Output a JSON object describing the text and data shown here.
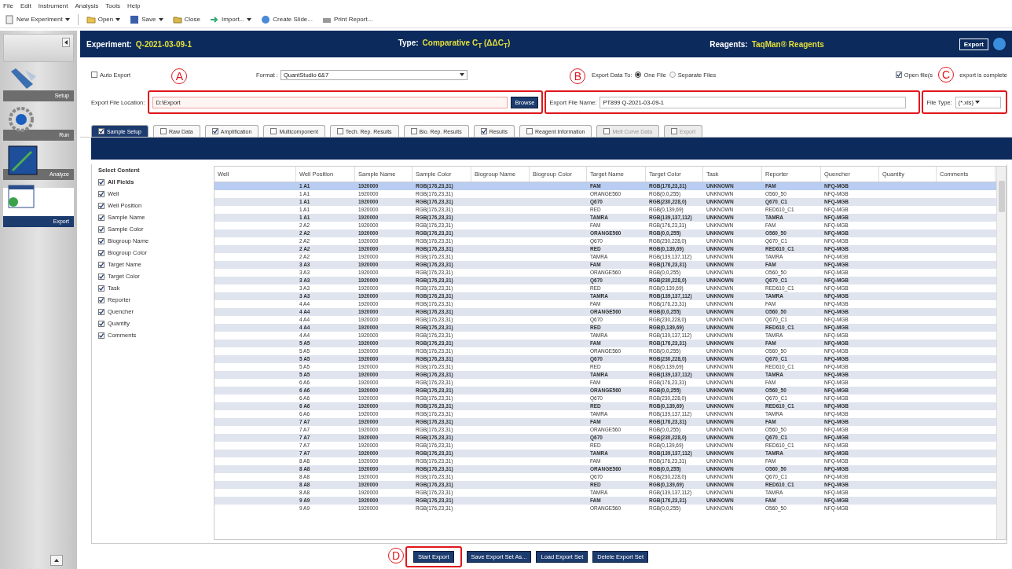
{
  "menu": [
    "File",
    "Edit",
    "Instrument",
    "Analysis",
    "Tools",
    "Help"
  ],
  "toolbar": [
    {
      "label": "New Experiment",
      "kind": "new",
      "dropdown": true
    },
    {
      "label": "Open",
      "kind": "open",
      "dropdown": true
    },
    {
      "label": "Save",
      "kind": "save",
      "dropdown": true
    },
    {
      "label": "Close",
      "kind": "close",
      "dropdown": false
    },
    {
      "label": "Import...",
      "kind": "import",
      "dropdown": true
    },
    {
      "label": "Create Slide...",
      "kind": "slide",
      "dropdown": false
    },
    {
      "label": "Print Report...",
      "kind": "print",
      "dropdown": false
    }
  ],
  "sidebar": {
    "items": [
      {
        "label": "Setup",
        "kind": "setup",
        "selected": false
      },
      {
        "label": "Run",
        "kind": "run",
        "selected": false
      },
      {
        "label": "Analyze",
        "kind": "analyze",
        "selected": false
      },
      {
        "label": "Export",
        "kind": "export",
        "selected": true
      }
    ]
  },
  "header": {
    "experiment_label": "Experiment:",
    "experiment": "Q-2021-03-09-1",
    "type_label": "Type:",
    "type": "Comparative C$_{T}$ (ΔΔC$_{T}$)",
    "reagents_label": "Reagents:",
    "reagents": "TaqMan® Reagents",
    "export_button": "Export"
  },
  "options": {
    "auto_export": {
      "label": "Auto Export",
      "checked": false
    },
    "format": {
      "label": "Format :",
      "value": "QuantStudio 6&7"
    },
    "export_data_to": {
      "label": "Export Data To:",
      "options": [
        {
          "label": "One File",
          "selected": true
        },
        {
          "label": "Separate Files",
          "selected": false
        }
      ]
    },
    "open_files": {
      "label_start": "Open file(s",
      "label_end": "export is complete",
      "checked": true
    },
    "location": {
      "label": "Export File Location:",
      "value": "D:\\Export",
      "button": "Browse",
      "annotation": "A"
    },
    "file_name": {
      "label": "Export File Name:",
      "value": "PT899 Q-2021-03-09-1",
      "annotation": "B"
    },
    "file_type": {
      "label": "File Type:",
      "value": "(*.xls)",
      "annotation": "C"
    }
  },
  "tabs": [
    {
      "label": "Sample Setup",
      "checked": true,
      "selected": true,
      "disabled": false
    },
    {
      "label": "Raw Data",
      "checked": false,
      "selected": false,
      "disabled": false
    },
    {
      "label": "Amplification",
      "checked": true,
      "selected": false,
      "disabled": false
    },
    {
      "label": "Multicomponent",
      "checked": false,
      "selected": false,
      "disabled": false
    },
    {
      "label": "Tech. Rep. Results",
      "checked": false,
      "selected": false,
      "disabled": false
    },
    {
      "label": "Bio. Rep. Results",
      "checked": false,
      "selected": false,
      "disabled": false
    },
    {
      "label": "Results",
      "checked": true,
      "selected": false,
      "disabled": false
    },
    {
      "label": "Reagent Information",
      "checked": false,
      "selected": false,
      "disabled": false
    },
    {
      "label": "Melt Curve Data",
      "checked": false,
      "selected": false,
      "disabled": true
    },
    {
      "label": "Export",
      "checked": false,
      "selected": false,
      "disabled": true
    }
  ],
  "content": {
    "title": "Select Content",
    "fields": [
      {
        "label": "All Fields",
        "kind": "all",
        "checked": true
      },
      {
        "label": "Well",
        "kind": "field",
        "checked": true
      },
      {
        "label": "Well Position",
        "kind": "field",
        "checked": true
      },
      {
        "label": "Sample Name",
        "kind": "field",
        "checked": true
      },
      {
        "label": "Sample Color",
        "kind": "field",
        "checked": true
      },
      {
        "label": "Biogroup Name",
        "kind": "field",
        "checked": true
      },
      {
        "label": "Biogroup Color",
        "kind": "field",
        "checked": true
      },
      {
        "label": "Target Name",
        "kind": "field",
        "checked": true
      },
      {
        "label": "Target Color",
        "kind": "field",
        "checked": true
      },
      {
        "label": "Task",
        "kind": "field",
        "checked": true
      },
      {
        "label": "Reporter",
        "kind": "field",
        "checked": true
      },
      {
        "label": "Quencher",
        "kind": "field",
        "checked": true
      },
      {
        "label": "Quantity",
        "kind": "field",
        "checked": true
      },
      {
        "label": "Comments",
        "kind": "field",
        "checked": true
      }
    ]
  },
  "table": {
    "columns": [
      "Well",
      "Well Position",
      "Sample Name",
      "Sample Color",
      "Biogroup Name",
      "Biogroup Color",
      "Target Name",
      "Target Color",
      "Task",
      "Reporter",
      "Quencher",
      "Quantity",
      "Comments"
    ],
    "rows": [
      {
        "selected": true,
        "cells": [
          "",
          "1 A1",
          "1920000",
          "RGB(176,23,31)",
          "",
          "",
          "FAM",
          "RGB(176,23,31)",
          "UNKNOWN",
          "FAM",
          "NFQ-MGB",
          "",
          ""
        ]
      },
      {
        "selected": false,
        "cells": [
          "",
          "1 A1",
          "1920000",
          "RGB(176,23,31)",
          "",
          "",
          "ORANGE560",
          "RGB(0,0,255)",
          "UNKNOWN",
          "O560_50",
          "NFQ-MGB",
          "",
          ""
        ]
      },
      {
        "selected": false,
        "cells": [
          "",
          "1 A1",
          "1920000",
          "RGB(176,23,31)",
          "",
          "",
          "Q670",
          "RGB(230,228,0)",
          "UNKNOWN",
          "Q670_C1",
          "NFQ-MGB",
          "",
          ""
        ]
      },
      {
        "selected": false,
        "cells": [
          "",
          "1 A1",
          "1920000",
          "RGB(176,23,31)",
          "",
          "",
          "RED",
          "RGB(0,139,69)",
          "UNKNOWN",
          "RED610_C1",
          "NFQ-MGB",
          "",
          ""
        ]
      },
      {
        "selected": false,
        "cells": [
          "",
          "1 A1",
          "1920000",
          "RGB(176,23,31)",
          "",
          "",
          "TAMRA",
          "RGB(139,137,112)",
          "UNKNOWN",
          "TAMRA",
          "NFQ-MGB",
          "",
          ""
        ]
      },
      {
        "selected": false,
        "cells": [
          "",
          "2 A2",
          "1920000",
          "RGB(176,23,31)",
          "",
          "",
          "FAM",
          "RGB(176,23,31)",
          "UNKNOWN",
          "FAM",
          "NFQ-MGB",
          "",
          ""
        ]
      },
      {
        "selected": false,
        "cells": [
          "",
          "2 A2",
          "1920000",
          "RGB(176,23,31)",
          "",
          "",
          "ORANGE560",
          "RGB(0,0,255)",
          "UNKNOWN",
          "O560_50",
          "NFQ-MGB",
          "",
          ""
        ]
      },
      {
        "selected": false,
        "cells": [
          "",
          "2 A2",
          "1920000",
          "RGB(176,23,31)",
          "",
          "",
          "Q670",
          "RGB(230,228,0)",
          "UNKNOWN",
          "Q670_C1",
          "NFQ-MGB",
          "",
          ""
        ]
      },
      {
        "selected": false,
        "cells": [
          "",
          "2 A2",
          "1920000",
          "RGB(176,23,31)",
          "",
          "",
          "RED",
          "RGB(0,139,69)",
          "UNKNOWN",
          "RED610_C1",
          "NFQ-MGB",
          "",
          ""
        ]
      },
      {
        "selected": false,
        "cells": [
          "",
          "2 A2",
          "1920000",
          "RGB(176,23,31)",
          "",
          "",
          "TAMRA",
          "RGB(139,137,112)",
          "UNKNOWN",
          "TAMRA",
          "NFQ-MGB",
          "",
          ""
        ]
      },
      {
        "selected": false,
        "cells": [
          "",
          "3 A3",
          "1920000",
          "RGB(176,23,31)",
          "",
          "",
          "FAM",
          "RGB(176,23,31)",
          "UNKNOWN",
          "FAM",
          "NFQ-MGB",
          "",
          ""
        ]
      },
      {
        "selected": false,
        "cells": [
          "",
          "3 A3",
          "1920000",
          "RGB(176,23,31)",
          "",
          "",
          "ORANGE560",
          "RGB(0,0,255)",
          "UNKNOWN",
          "O560_50",
          "NFQ-MGB",
          "",
          ""
        ]
      },
      {
        "selected": false,
        "cells": [
          "",
          "3 A3",
          "1920000",
          "RGB(176,23,31)",
          "",
          "",
          "Q670",
          "RGB(230,228,0)",
          "UNKNOWN",
          "Q670_C1",
          "NFQ-MGB",
          "",
          ""
        ]
      },
      {
        "selected": false,
        "cells": [
          "",
          "3 A3",
          "1920000",
          "RGB(176,23,31)",
          "",
          "",
          "RED",
          "RGB(0,139,69)",
          "UNKNOWN",
          "RED610_C1",
          "NFQ-MGB",
          "",
          ""
        ]
      },
      {
        "selected": false,
        "cells": [
          "",
          "3 A3",
          "1920000",
          "RGB(176,23,31)",
          "",
          "",
          "TAMRA",
          "RGB(139,137,112)",
          "UNKNOWN",
          "TAMRA",
          "NFQ-MGB",
          "",
          ""
        ]
      },
      {
        "selected": false,
        "cells": [
          "",
          "4 A4",
          "1920000",
          "RGB(176,23,31)",
          "",
          "",
          "FAM",
          "RGB(176,23,31)",
          "UNKNOWN",
          "FAM",
          "NFQ-MGB",
          "",
          ""
        ]
      },
      {
        "selected": false,
        "cells": [
          "",
          "4 A4",
          "1920000",
          "RGB(176,23,31)",
          "",
          "",
          "ORANGE560",
          "RGB(0,0,255)",
          "UNKNOWN",
          "O560_50",
          "NFQ-MGB",
          "",
          ""
        ]
      },
      {
        "selected": false,
        "cells": [
          "",
          "4 A4",
          "1920000",
          "RGB(176,23,31)",
          "",
          "",
          "Q670",
          "RGB(230,228,0)",
          "UNKNOWN",
          "Q670_C1",
          "NFQ-MGB",
          "",
          ""
        ]
      },
      {
        "selected": false,
        "cells": [
          "",
          "4 A4",
          "1920000",
          "RGB(176,23,31)",
          "",
          "",
          "RED",
          "RGB(0,139,69)",
          "UNKNOWN",
          "RED610_C1",
          "NFQ-MGB",
          "",
          ""
        ]
      },
      {
        "selected": false,
        "cells": [
          "",
          "4 A4",
          "1920000",
          "RGB(176,23,31)",
          "",
          "",
          "TAMRA",
          "RGB(139,137,112)",
          "UNKNOWN",
          "TAMRA",
          "NFQ-MGB",
          "",
          ""
        ]
      },
      {
        "selected": false,
        "cells": [
          "",
          "5 A5",
          "1920000",
          "RGB(176,23,31)",
          "",
          "",
          "FAM",
          "RGB(176,23,31)",
          "UNKNOWN",
          "FAM",
          "NFQ-MGB",
          "",
          ""
        ]
      },
      {
        "selected": false,
        "cells": [
          "",
          "5 A5",
          "1920000",
          "RGB(176,23,31)",
          "",
          "",
          "ORANGE560",
          "RGB(0,0,255)",
          "UNKNOWN",
          "O560_50",
          "NFQ-MGB",
          "",
          ""
        ]
      },
      {
        "selected": false,
        "cells": [
          "",
          "5 A5",
          "1920000",
          "RGB(176,23,31)",
          "",
          "",
          "Q670",
          "RGB(230,228,0)",
          "UNKNOWN",
          "Q670_C1",
          "NFQ-MGB",
          "",
          ""
        ]
      },
      {
        "selected": false,
        "cells": [
          "",
          "5 A5",
          "1920000",
          "RGB(176,23,31)",
          "",
          "",
          "RED",
          "RGB(0,139,69)",
          "UNKNOWN",
          "RED610_C1",
          "NFQ-MGB",
          "",
          ""
        ]
      },
      {
        "selected": false,
        "cells": [
          "",
          "5 A5",
          "1920000",
          "RGB(176,23,31)",
          "",
          "",
          "TAMRA",
          "RGB(139,137,112)",
          "UNKNOWN",
          "TAMRA",
          "NFQ-MGB",
          "",
          ""
        ]
      },
      {
        "selected": false,
        "cells": [
          "",
          "6 A6",
          "1920000",
          "RGB(176,23,31)",
          "",
          "",
          "FAM",
          "RGB(176,23,31)",
          "UNKNOWN",
          "FAM",
          "NFQ-MGB",
          "",
          ""
        ]
      },
      {
        "selected": false,
        "cells": [
          "",
          "6 A6",
          "1920000",
          "RGB(176,23,31)",
          "",
          "",
          "ORANGE560",
          "RGB(0,0,255)",
          "UNKNOWN",
          "O560_50",
          "NFQ-MGB",
          "",
          ""
        ]
      },
      {
        "selected": false,
        "cells": [
          "",
          "6 A6",
          "1920000",
          "RGB(176,23,31)",
          "",
          "",
          "Q670",
          "RGB(230,228,0)",
          "UNKNOWN",
          "Q670_C1",
          "NFQ-MGB",
          "",
          ""
        ]
      },
      {
        "selected": false,
        "cells": [
          "",
          "6 A6",
          "1920000",
          "RGB(176,23,31)",
          "",
          "",
          "RED",
          "RGB(0,139,69)",
          "UNKNOWN",
          "RED610_C1",
          "NFQ-MGB",
          "",
          ""
        ]
      },
      {
        "selected": false,
        "cells": [
          "",
          "6 A6",
          "1920000",
          "RGB(176,23,31)",
          "",
          "",
          "TAMRA",
          "RGB(139,137,112)",
          "UNKNOWN",
          "TAMRA",
          "NFQ-MGB",
          "",
          ""
        ]
      },
      {
        "selected": false,
        "cells": [
          "",
          "7 A7",
          "1920000",
          "RGB(176,23,31)",
          "",
          "",
          "FAM",
          "RGB(176,23,31)",
          "UNKNOWN",
          "FAM",
          "NFQ-MGB",
          "",
          ""
        ]
      },
      {
        "selected": false,
        "cells": [
          "",
          "7 A7",
          "1920000",
          "RGB(176,23,31)",
          "",
          "",
          "ORANGE560",
          "RGB(0,0,255)",
          "UNKNOWN",
          "O560_50",
          "NFQ-MGB",
          "",
          ""
        ]
      },
      {
        "selected": false,
        "cells": [
          "",
          "7 A7",
          "1920000",
          "RGB(176,23,31)",
          "",
          "",
          "Q670",
          "RGB(230,228,0)",
          "UNKNOWN",
          "Q670_C1",
          "NFQ-MGB",
          "",
          ""
        ]
      },
      {
        "selected": false,
        "cells": [
          "",
          "7 A7",
          "1920000",
          "RGB(176,23,31)",
          "",
          "",
          "RED",
          "RGB(0,139,69)",
          "UNKNOWN",
          "RED610_C1",
          "NFQ-MGB",
          "",
          ""
        ]
      },
      {
        "selected": false,
        "cells": [
          "",
          "7 A7",
          "1920000",
          "RGB(176,23,31)",
          "",
          "",
          "TAMRA",
          "RGB(139,137,112)",
          "UNKNOWN",
          "TAMRA",
          "NFQ-MGB",
          "",
          ""
        ]
      },
      {
        "selected": false,
        "cells": [
          "",
          "8 A8",
          "1920000",
          "RGB(176,23,31)",
          "",
          "",
          "FAM",
          "RGB(176,23,31)",
          "UNKNOWN",
          "FAM",
          "NFQ-MGB",
          "",
          ""
        ]
      },
      {
        "selected": false,
        "cells": [
          "",
          "8 A8",
          "1920000",
          "RGB(176,23,31)",
          "",
          "",
          "ORANGE560",
          "RGB(0,0,255)",
          "UNKNOWN",
          "O560_50",
          "NFQ-MGB",
          "",
          ""
        ]
      },
      {
        "selected": false,
        "cells": [
          "",
          "8 A8",
          "1920000",
          "RGB(176,23,31)",
          "",
          "",
          "Q670",
          "RGB(230,228,0)",
          "UNKNOWN",
          "Q670_C1",
          "NFQ-MGB",
          "",
          ""
        ]
      },
      {
        "selected": false,
        "cells": [
          "",
          "8 A8",
          "1920000",
          "RGB(176,23,31)",
          "",
          "",
          "RED",
          "RGB(0,139,69)",
          "UNKNOWN",
          "RED610_C1",
          "NFQ-MGB",
          "",
          ""
        ]
      },
      {
        "selected": false,
        "cells": [
          "",
          "8 A8",
          "1920000",
          "RGB(176,23,31)",
          "",
          "",
          "TAMRA",
          "RGB(139,137,112)",
          "UNKNOWN",
          "TAMRA",
          "NFQ-MGB",
          "",
          ""
        ]
      },
      {
        "selected": false,
        "cells": [
          "",
          "9 A9",
          "1920000",
          "RGB(176,23,31)",
          "",
          "",
          "FAM",
          "RGB(176,23,31)",
          "UNKNOWN",
          "FAM",
          "NFQ-MGB",
          "",
          ""
        ]
      },
      {
        "selected": false,
        "cells": [
          "",
          "9 A9",
          "1920000",
          "RGB(176,23,31)",
          "",
          "",
          "ORANGE560",
          "RGB(0,0,255)",
          "UNKNOWN",
          "O560_50",
          "NFQ-MGB",
          "",
          ""
        ]
      }
    ]
  },
  "actions": [
    {
      "label": "Start Export",
      "annotation": "D"
    },
    {
      "label": "Save Export Set As..."
    },
    {
      "label": "Load Export Set"
    },
    {
      "label": "Delete Export Set"
    }
  ]
}
